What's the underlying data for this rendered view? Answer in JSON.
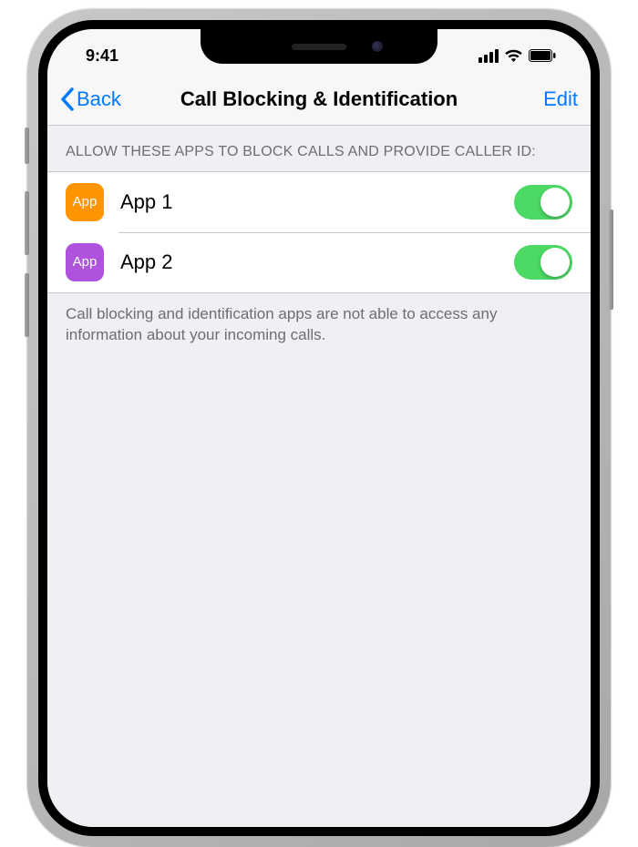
{
  "status": {
    "time": "9:41"
  },
  "nav": {
    "back_label": "Back",
    "title": "Call Blocking & Identification",
    "edit_label": "Edit"
  },
  "section": {
    "header": "ALLOW THESE APPS TO BLOCK CALLS AND PROVIDE CALLER ID:",
    "footer": "Call blocking and identification apps are not able to access any information about your incoming calls."
  },
  "apps": [
    {
      "badge": "App",
      "name": "App 1",
      "color": "#ff9500",
      "enabled": true
    },
    {
      "badge": "App",
      "name": "App 2",
      "color": "#af52de",
      "enabled": true
    }
  ]
}
